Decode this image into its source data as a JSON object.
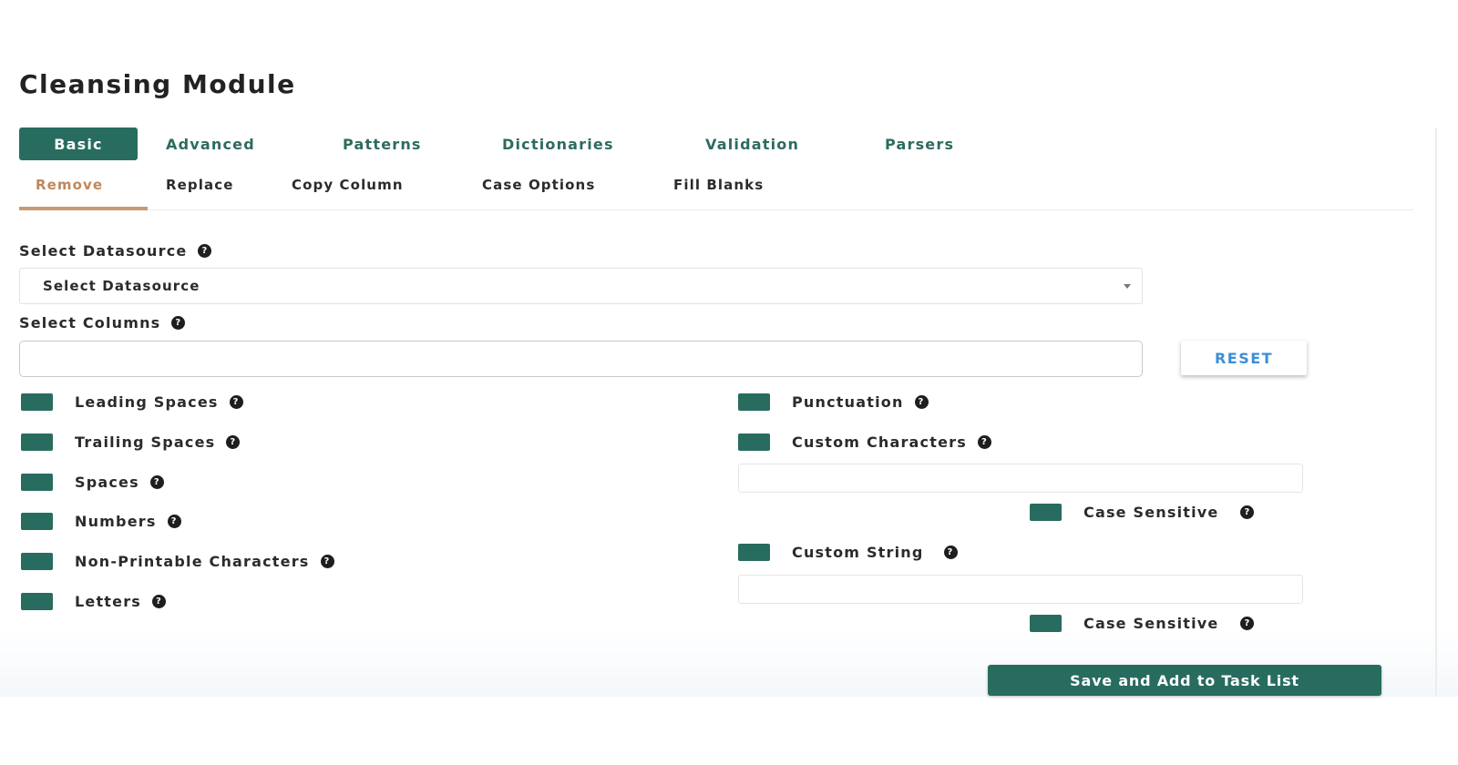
{
  "page": {
    "title": "Cleansing Module"
  },
  "tabs": [
    "Basic",
    "Advanced",
    "Patterns",
    "Dictionaries",
    "Validation",
    "Parsers"
  ],
  "active_tab": "Basic",
  "subtabs": [
    "Remove",
    "Replace",
    "Copy Column",
    "Case Options",
    "Fill Blanks"
  ],
  "active_subtab": "Remove",
  "datasource": {
    "label": "Select Datasource",
    "selected": "Select Datasource"
  },
  "columns": {
    "label": "Select Columns",
    "value": "",
    "reset_label": "RESET"
  },
  "help_glyph": "?",
  "left_options": [
    "Leading Spaces",
    "Trailing Spaces",
    "Spaces",
    "Numbers",
    "Non-Printable Characters",
    "Letters"
  ],
  "right_options": {
    "punctuation": "Punctuation",
    "custom_characters": "Custom Characters",
    "custom_characters_case": "Case Sensitive",
    "custom_string": "Custom String",
    "custom_string_case": "Case Sensitive"
  },
  "save_label": "Save and Add to Task List",
  "colors": {
    "primary": "#286c5f",
    "active_subtab": "#c0875a",
    "reset": "#3c8fd6"
  }
}
